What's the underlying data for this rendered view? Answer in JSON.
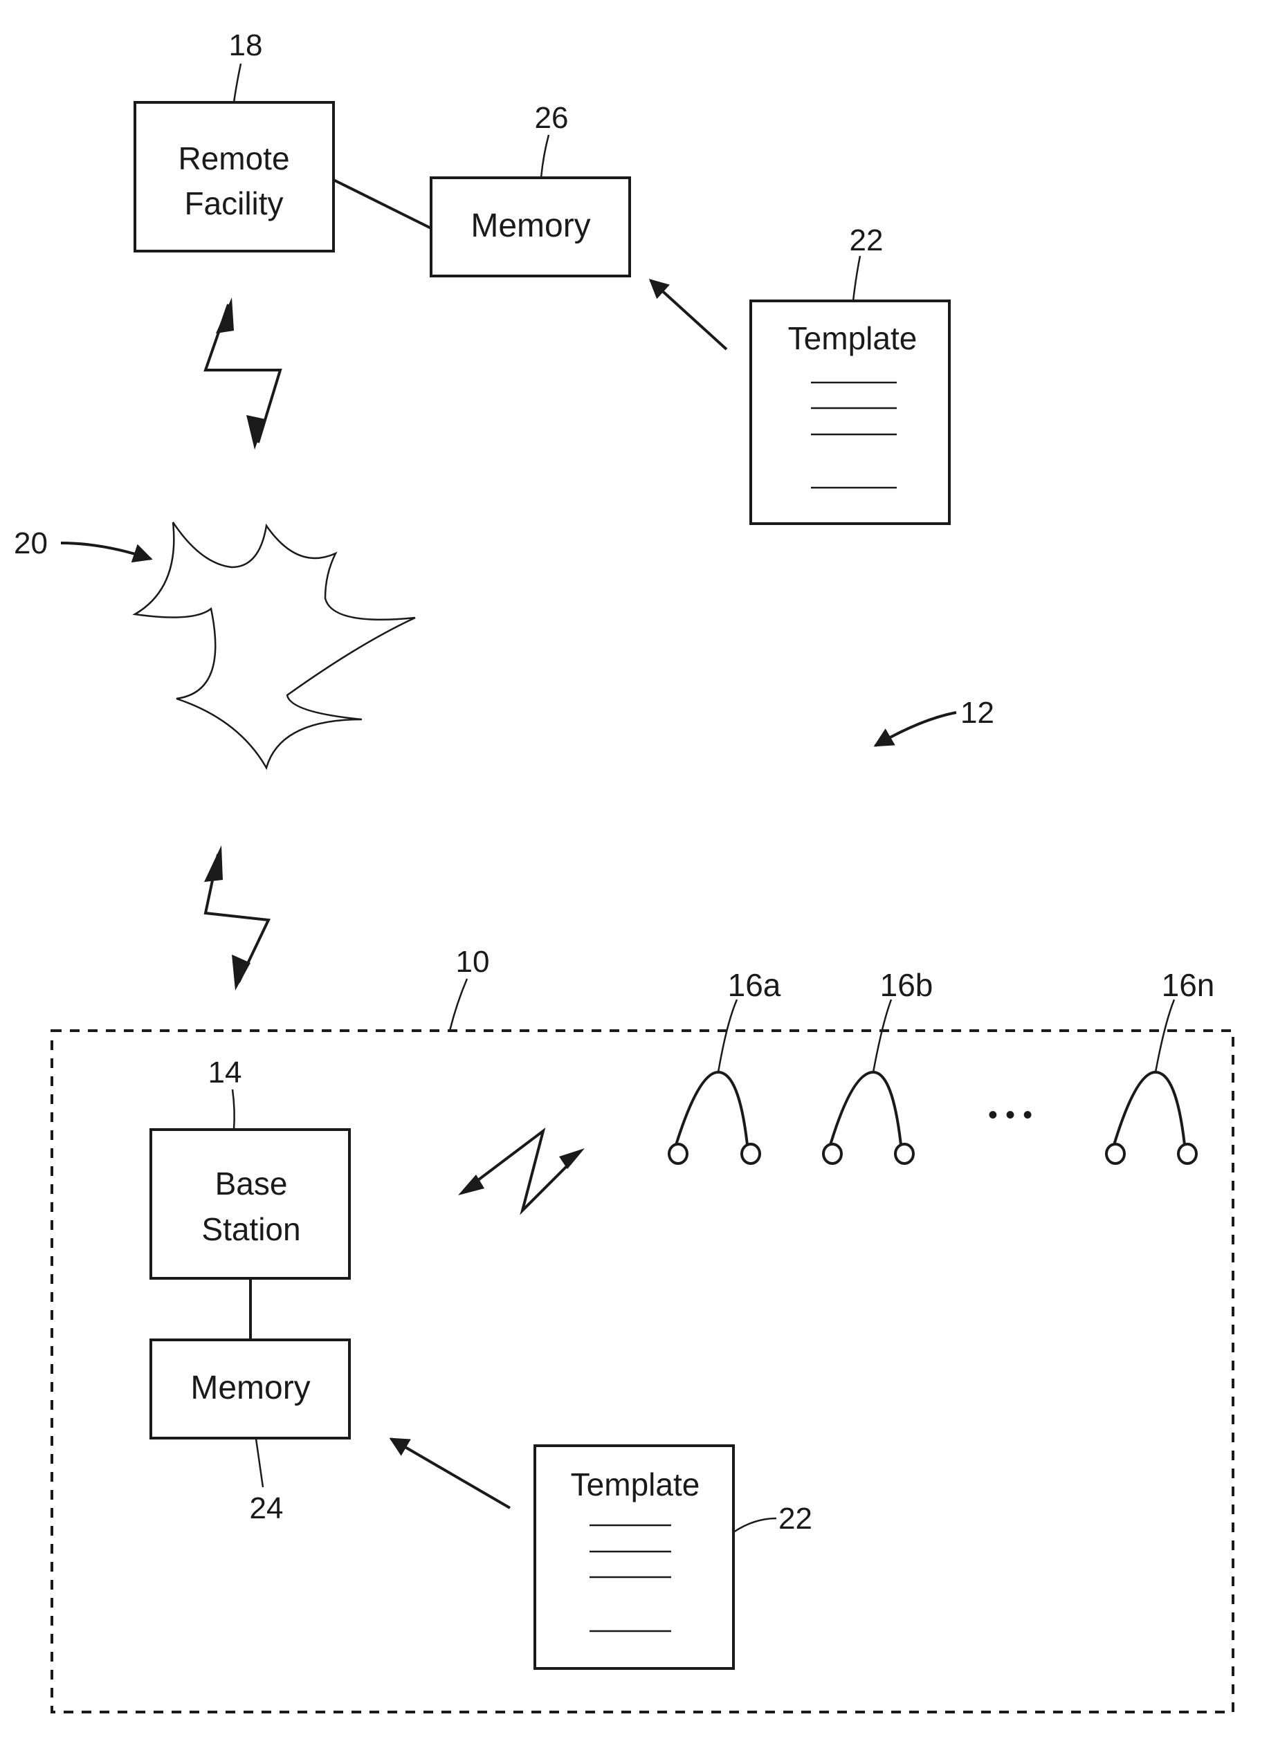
{
  "figure": {
    "remote_facility": {
      "label_line1": "Remote",
      "label_line2": "Facility",
      "ref": "18"
    },
    "remote_memory": {
      "label": "Memory",
      "ref": "26"
    },
    "template_top": {
      "label": "Template",
      "ref": "22"
    },
    "network": {
      "ref": "20"
    },
    "system": {
      "ref": "12"
    },
    "local_system": {
      "ref": "10"
    },
    "base_station": {
      "label_line1": "Base",
      "label_line2": "Station",
      "ref": "14"
    },
    "local_memory": {
      "label": "Memory",
      "ref": "24"
    },
    "template_bottom": {
      "label": "Template",
      "ref": "22"
    },
    "sensors": [
      {
        "ref": "16a"
      },
      {
        "ref": "16b"
      },
      {
        "ref": "16n"
      }
    ],
    "ellipsis": "• • •"
  }
}
